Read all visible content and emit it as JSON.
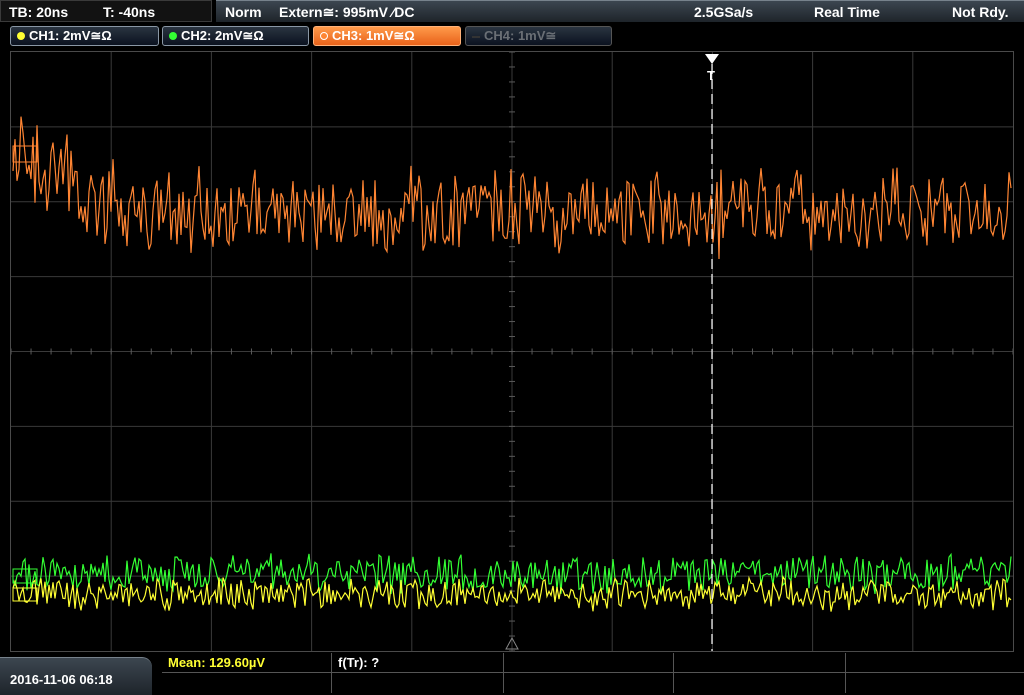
{
  "topbar": {
    "timebase": "TB: 20ns",
    "trigger_time": "T: -40ns",
    "mode": "Norm",
    "source": "Extern≅: 995mV ⁄DC",
    "sample_rate": "2.5GSa/s",
    "acq": "Real Time",
    "status": "Not Rdy."
  },
  "channels": [
    {
      "label": "CH1: 2mV≅Ω",
      "color": "#ffff33",
      "state": "on"
    },
    {
      "label": "CH2: 2mV≅Ω",
      "color": "#33ff33",
      "state": "on"
    },
    {
      "label": "CH3: 1mV≅Ω",
      "color": "#ff8533",
      "state": "active"
    },
    {
      "label": "CH4: 1mV≅",
      "color": "#5a6066",
      "state": "off"
    }
  ],
  "trigger_marker": "T",
  "measurements": {
    "mean": "Mean: 129.60µV",
    "freq": "f(Tr): ?"
  },
  "datetime": "2016-11-06 06:18",
  "colors": {
    "ch1": "#ffff33",
    "ch2": "#33ff33",
    "ch3": "#ff8533",
    "grid": "#3a3a3a"
  }
}
